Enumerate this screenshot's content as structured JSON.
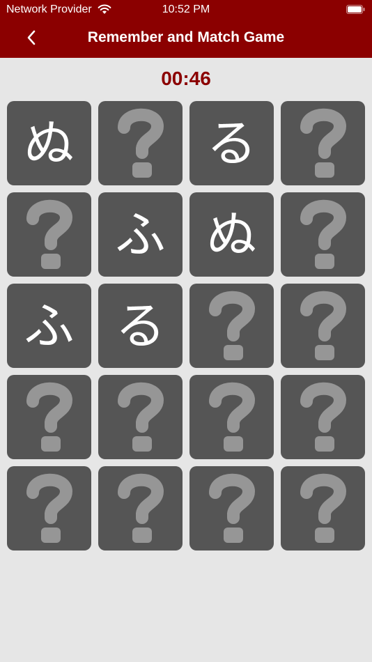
{
  "status_bar": {
    "carrier": "Network Provider",
    "time": "10:52 PM"
  },
  "nav": {
    "title": "Remember and Match Game",
    "back_icon": "chevron-left-icon"
  },
  "game": {
    "timer": "00:46",
    "columns": 4,
    "hidden_icon": "question-mark-icon",
    "colors": {
      "header": "#8b0000",
      "timer": "#8b0000",
      "card": "#555555",
      "question_mark": "#969696",
      "background": "#e6e6e6"
    },
    "cards": [
      {
        "state": "revealed",
        "symbol": "ぬ"
      },
      {
        "state": "hidden",
        "symbol": ""
      },
      {
        "state": "revealed",
        "symbol": "る"
      },
      {
        "state": "hidden",
        "symbol": ""
      },
      {
        "state": "hidden",
        "symbol": ""
      },
      {
        "state": "revealed",
        "symbol": "ふ"
      },
      {
        "state": "revealed",
        "symbol": "ぬ"
      },
      {
        "state": "hidden",
        "symbol": ""
      },
      {
        "state": "revealed",
        "symbol": "ふ"
      },
      {
        "state": "revealed",
        "symbol": "る"
      },
      {
        "state": "hidden",
        "symbol": ""
      },
      {
        "state": "hidden",
        "symbol": ""
      },
      {
        "state": "hidden",
        "symbol": ""
      },
      {
        "state": "hidden",
        "symbol": ""
      },
      {
        "state": "hidden",
        "symbol": ""
      },
      {
        "state": "hidden",
        "symbol": ""
      },
      {
        "state": "hidden",
        "symbol": ""
      },
      {
        "state": "hidden",
        "symbol": ""
      },
      {
        "state": "hidden",
        "symbol": ""
      },
      {
        "state": "hidden",
        "symbol": ""
      }
    ]
  }
}
